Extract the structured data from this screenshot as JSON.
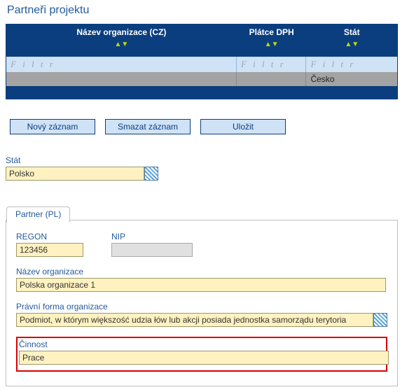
{
  "title": "Partneři projektu",
  "table": {
    "headers": {
      "org": "Název organizace (CZ)",
      "vat": "Plátce DPH",
      "country": "Stát"
    },
    "filter_placeholder": "F i l t r",
    "row0": {
      "org": "",
      "vat": "",
      "country": "Česko"
    }
  },
  "buttons": {
    "new": "Nový záznam",
    "delete": "Smazat záznam",
    "save": "Uložit"
  },
  "form": {
    "stat_label": "Stát",
    "stat_value": "Polsko",
    "tab_label": "Partner (PL)",
    "regon_label": "REGON",
    "regon_value": "123456",
    "nip_label": "NIP",
    "nip_value": "",
    "org_label": "Název organizace",
    "org_value": "Polska organizace 1",
    "legal_label": "Právní forma organizace",
    "legal_value": "Podmiot, w którym większość udzia łów lub akcji posiada jednostka samorządu terytoria",
    "activity_label": "Činnost",
    "activity_value": "Prace"
  }
}
